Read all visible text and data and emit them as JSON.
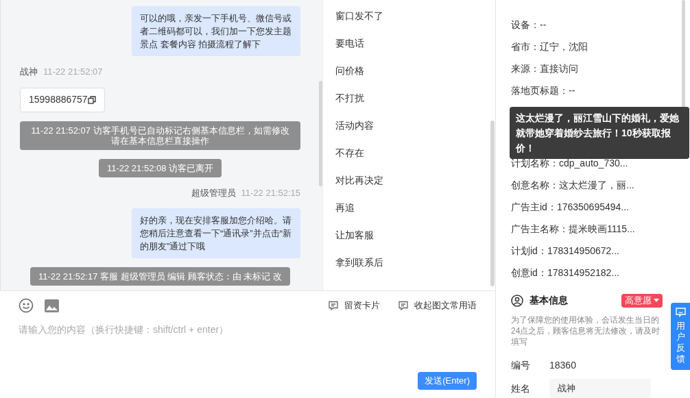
{
  "chat": {
    "messages": [
      {
        "kind": "bubble",
        "text": "可以的哦，亲发一下手机号、微信号或者二维码都可以，我们加一下您发主题景点 套餐内容 拍摄流程了解下"
      },
      {
        "kind": "sender_left",
        "name": "战神",
        "time": "11-22 21:52:07"
      },
      {
        "kind": "phone",
        "text": "15998886757"
      },
      {
        "kind": "system",
        "text": "11-22 21:52:07 访客手机号已自动标记右侧基本信息栏，如需修改请在基本信息栏直接操作"
      },
      {
        "kind": "system",
        "text": "11-22 21:52:08 访客已离开"
      },
      {
        "kind": "sender_right",
        "name": "超级管理员",
        "time": "11-22 21:52:15"
      },
      {
        "kind": "bubble",
        "text": "好的亲，现在安排客服加您介绍哈。请您稍后注意查看一下“通讯录”并点击“新的朋友”通过下哦"
      },
      {
        "kind": "system",
        "text": "11-22 21:52:17 客服 超级管理员 编辑 顾客状态：由 未标记 改"
      }
    ]
  },
  "quick_replies": [
    "窗口发不了",
    "要电话",
    "问价格",
    "不打扰",
    "活动内容",
    "不存在",
    "对比再决定",
    "再追",
    "让加客服",
    "拿到联系后"
  ],
  "composer": {
    "actions": [
      "留资卡片",
      "收起图文常用语"
    ],
    "placeholder": "请输入您的内容（换行快捷键：shift/ctrl + enter）",
    "send_button": "发送(Enter)"
  },
  "visitor_info": {
    "fields": [
      {
        "kind": "text",
        "text": "设备：--"
      },
      {
        "kind": "text",
        "text": "省市：辽宁，沈阳"
      },
      {
        "kind": "text",
        "text": "来源：直接访问"
      },
      {
        "kind": "text",
        "text": "落地页标题：--"
      },
      {
        "kind": "tooltip",
        "text": "这太烂漫了，丽江雪山下的婚礼，爱她就带她穿着婚纱去旅行！10秒获取报价！"
      },
      {
        "kind": "text",
        "text": "计划名称：cdp_auto_730..."
      },
      {
        "kind": "text",
        "text": "创意名称：这太烂漫了，丽..."
      },
      {
        "kind": "text",
        "text": "广告主id：176350695494..."
      },
      {
        "kind": "text",
        "text": "广告主名称：提米映画1115..."
      },
      {
        "kind": "text",
        "text": "计划id：178314950672..."
      },
      {
        "kind": "text",
        "text": "创意id：178314952182..."
      }
    ]
  },
  "basic_info": {
    "title": "基本信息",
    "intent_tag": "高意愿",
    "notice": "为了保障您的使用体验，会话发生当日的24点之后，顾客信息将无法修改，请及时填写",
    "fields": [
      {
        "kind": "text",
        "label": "编号",
        "value": "18360"
      },
      {
        "kind": "input",
        "label": "姓名",
        "value": "战神"
      }
    ]
  },
  "feedback_button": "用户反馈"
}
